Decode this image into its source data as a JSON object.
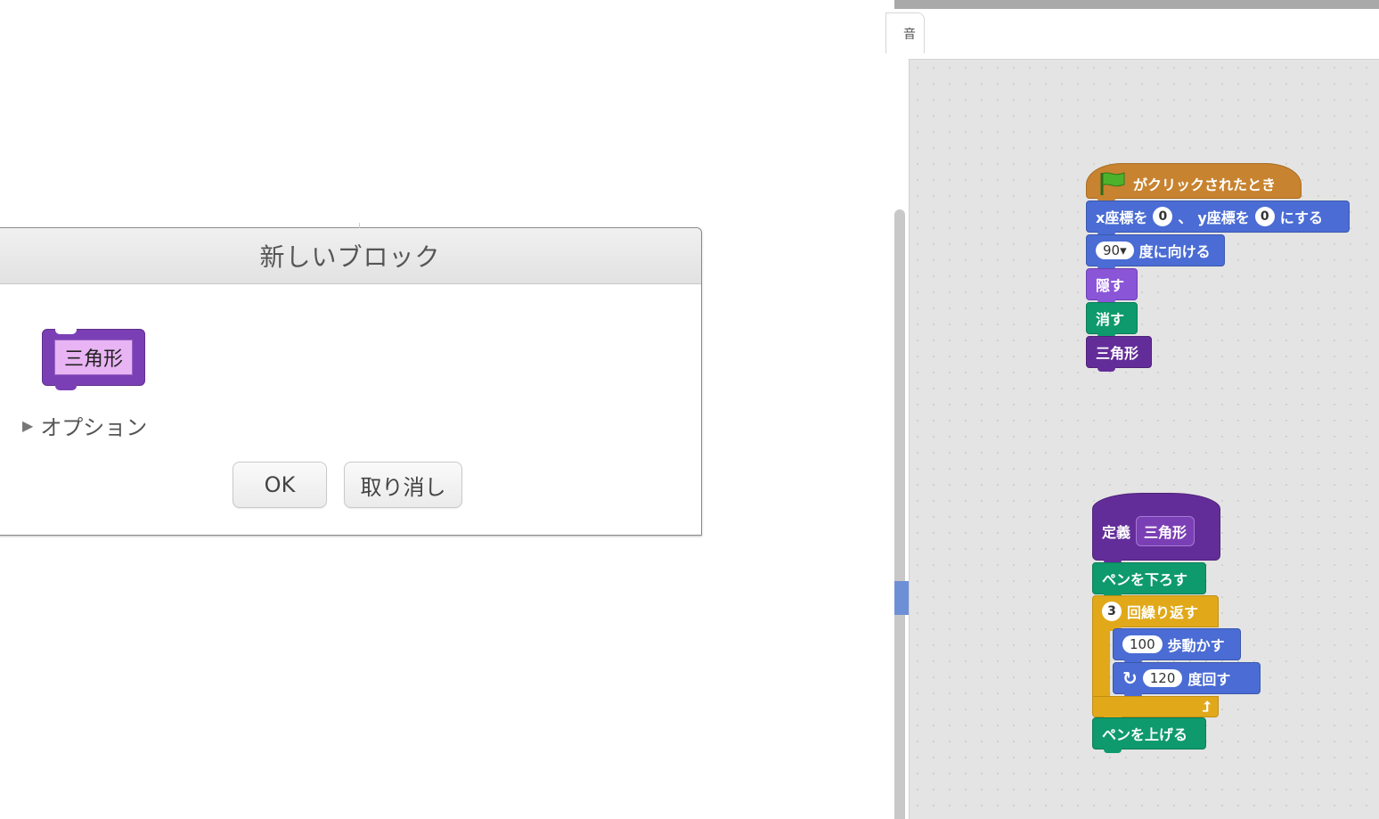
{
  "dialog": {
    "title": "新しいブロック",
    "preview_block_label": "三角形",
    "options_label": "オプション",
    "ok_label": "OK",
    "cancel_label": "取り消し"
  },
  "editor": {
    "tab_label": "音"
  },
  "script1": {
    "hat": "がクリックされたとき",
    "goto_x_prefix": "x座標を",
    "goto_x_value": "0",
    "goto_sep": "、",
    "goto_y_prefix": "y座標を",
    "goto_y_value": "0",
    "goto_suffix": "にする",
    "point_value": "90",
    "point_dropdown": "▾",
    "point_label": "度に向ける",
    "hide": "隠す",
    "clear": "消す",
    "custom_call": "三角形"
  },
  "script2": {
    "define_label": "定義",
    "define_name": "三角形",
    "pen_down": "ペンを下ろす",
    "repeat_count": "3",
    "repeat_label": "回繰り返す",
    "move_steps": "100",
    "move_label": "歩動かす",
    "turn_icon": "↻",
    "turn_degrees": "120",
    "turn_label": "度回す",
    "pen_up": "ペンを上げる"
  },
  "colors": {
    "motion": "#4a6cd4",
    "looks": "#8a55d7",
    "pen": "#0e9a6c",
    "custom": "#632d99",
    "control": "#e1a91a",
    "event": "#c88330"
  }
}
